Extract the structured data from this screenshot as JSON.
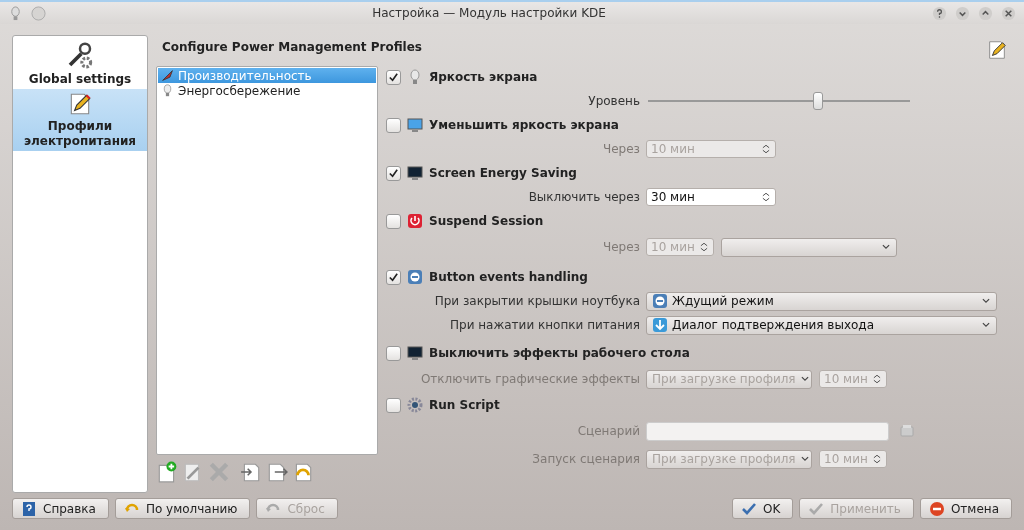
{
  "window": {
    "title": "Настройка — Модуль настройки KDE"
  },
  "sidebar": {
    "items": [
      {
        "label": "Global settings",
        "selected": false
      },
      {
        "label": "Профили электропитания",
        "selected": true
      }
    ]
  },
  "heading": "Configure Power Management Profiles",
  "profiles": [
    {
      "label": "Производительность",
      "selected": true
    },
    {
      "label": "Энергосбережение",
      "selected": false
    }
  ],
  "sections": [
    {
      "title": "Яркость экрана",
      "checked": true,
      "rows": [
        {
          "label": "Уровень",
          "controls": [
            {
              "kind": "slider",
              "level": 0.65
            }
          ]
        }
      ]
    },
    {
      "title": "Уменьшить яркость экрана",
      "checked": false,
      "rows": [
        {
          "label": "Через",
          "controls": [
            {
              "kind": "spin",
              "value": "10 мин"
            }
          ]
        }
      ]
    },
    {
      "title": "Screen Energy Saving",
      "checked": true,
      "rows": [
        {
          "label": "Выключить через",
          "controls": [
            {
              "kind": "spin",
              "value": "30 мин"
            }
          ]
        }
      ]
    },
    {
      "title": "Suspend Session",
      "checked": false,
      "rows": [
        {
          "label": "Через",
          "controls": [
            {
              "kind": "spin",
              "value": "10 мин"
            },
            {
              "kind": "combo"
            }
          ]
        }
      ]
    },
    {
      "title": "Button events handling",
      "checked": true,
      "rows": [
        {
          "label": "При закрытии крышки ноутбука",
          "controls": [
            {
              "kind": "combo",
              "value": "Ждущий режим"
            }
          ]
        },
        {
          "label": "При нажатии кнопки питания",
          "controls": [
            {
              "kind": "combo",
              "value": "Диалог подтверждения выхода"
            }
          ]
        }
      ]
    },
    {
      "title": "Выключить эффекты рабочего стола",
      "checked": false,
      "rows": [
        {
          "label": "Отключить графические эффекты",
          "controls": [
            {
              "kind": "combo",
              "value": "При загрузке профиля"
            },
            {
              "kind": "spin",
              "value": "10 мин"
            }
          ]
        }
      ]
    },
    {
      "title": "Run Script",
      "checked": false,
      "rows": [
        {
          "label": "Сценарий",
          "controls": [
            {
              "kind": "field"
            },
            {
              "kind": "browse"
            }
          ]
        },
        {
          "label": "Запуск сценария",
          "controls": [
            {
              "kind": "combo",
              "value": "При загрузке профиля"
            },
            {
              "kind": "spin",
              "value": "10 мин"
            }
          ]
        }
      ]
    }
  ],
  "buttons_left": [
    {
      "label": "Справка",
      "disabled": false
    },
    {
      "label": "По умолчанию",
      "disabled": false
    },
    {
      "label": "Сброс",
      "disabled": true
    }
  ],
  "buttons_right": [
    {
      "label": "OK",
      "disabled": false
    },
    {
      "label": "Применить",
      "disabled": true
    },
    {
      "label": "Отмена",
      "disabled": false
    }
  ]
}
